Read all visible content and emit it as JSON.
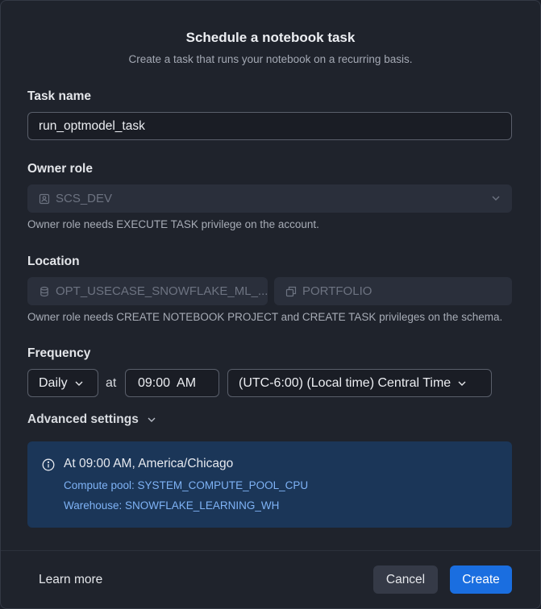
{
  "dialog": {
    "title": "Schedule a notebook task",
    "subtitle": "Create a task that runs your notebook on a recurring basis."
  },
  "task_name": {
    "label": "Task name",
    "value": "run_optmodel_task"
  },
  "owner_role": {
    "label": "Owner role",
    "value": "SCS_DEV",
    "hint": "Owner role needs EXECUTE TASK privilege on the account."
  },
  "location": {
    "label": "Location",
    "database": "OPT_USECASE_SNOWFLAKE_ML_...",
    "schema": "PORTFOLIO",
    "hint": "Owner role needs CREATE NOTEBOOK PROJECT and CREATE TASK privileges on the schema."
  },
  "frequency": {
    "label": "Frequency",
    "interval": "Daily",
    "at_label": "at",
    "time": "09:00  AM",
    "timezone": "(UTC-6:00) (Local time) Central Time"
  },
  "advanced": {
    "label": "Advanced settings"
  },
  "info": {
    "title": "At 09:00 AM, America/Chicago",
    "compute_pool": "Compute pool: SYSTEM_COMPUTE_POOL_CPU",
    "warehouse": "Warehouse: SNOWFLAKE_LEARNING_WH"
  },
  "footer": {
    "learn_more": "Learn more",
    "cancel": "Cancel",
    "create": "Create"
  },
  "colors": {
    "primary": "#1a6ee0",
    "info_bg": "#1b3658",
    "info_text": "#7fb3f6"
  }
}
